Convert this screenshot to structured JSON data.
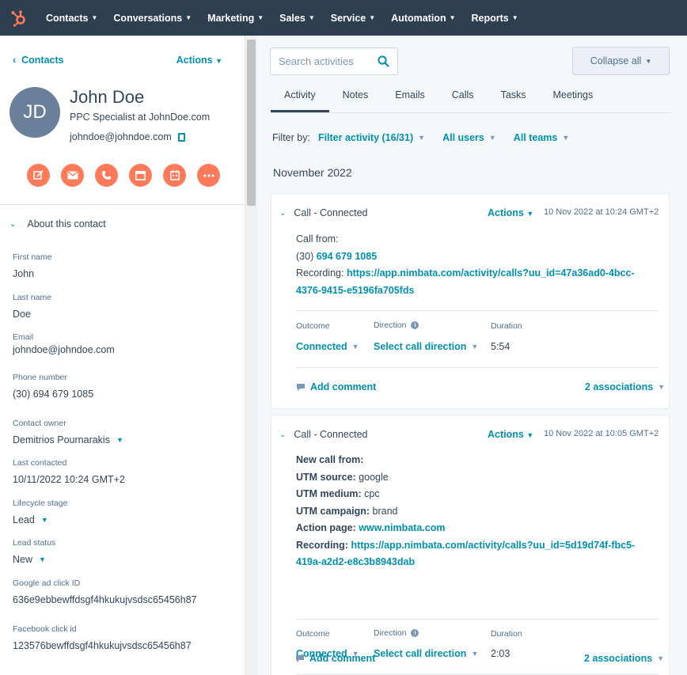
{
  "nav": {
    "items": [
      "Contacts",
      "Conversations",
      "Marketing",
      "Sales",
      "Service",
      "Automation",
      "Reports"
    ]
  },
  "sidebar": {
    "back_label": "Contacts",
    "actions_label": "Actions",
    "avatar_initials": "JD",
    "name": "John Doe",
    "job_title": "PPC Specialist at JohnDoe.com",
    "email": "johndoe@johndoe.com",
    "about_label": "About this contact",
    "props": {
      "first_name": {
        "label": "First name",
        "value": "John"
      },
      "last_name": {
        "label": "Last name",
        "value": "Doe"
      },
      "email": {
        "label": "Email",
        "value": "johndoe@johndoe.com"
      },
      "phone": {
        "label": "Phone number",
        "value": "(30) 694 679 1085"
      },
      "owner": {
        "label": "Contact owner",
        "value": "Demitrios Pournarakis"
      },
      "last_contacted": {
        "label": "Last contacted",
        "value": "10/11/2022 10:24 GMT+2"
      },
      "lifecycle": {
        "label": "Lifecycle stage",
        "value": "Lead"
      },
      "lead_status": {
        "label": "Lead status",
        "value": "New"
      },
      "google_click": {
        "label": "Google ad click ID",
        "value": "636e9ebbewffdsgf4hkukujvsdsc65456h87"
      },
      "facebook_click": {
        "label": "Facebook click id",
        "value": "123576bewffdsgf4hkukujvsdsc65456h87"
      }
    }
  },
  "main": {
    "search_placeholder": "Search activities",
    "collapse_label": "Collapse all",
    "tabs": [
      "Activity",
      "Notes",
      "Emails",
      "Calls",
      "Tasks",
      "Meetings"
    ],
    "filter_by": "Filter by:",
    "filter_activity": "Filter activity (16/31)",
    "all_users": "All users",
    "all_teams": "All teams",
    "month": "November 2022"
  },
  "cards": [
    {
      "title": "Call - Connected",
      "actions": "Actions",
      "date": "10 Nov 2022 at 10:24 GMT+2",
      "line1": "Call from:",
      "phone_prefix": "(30) ",
      "phone_link": "694 679 1085",
      "recording_label": "Recording: ",
      "recording_url_1": "https://app.nimbata.com/activity/calls?uu_id=47a36ad0-4bcc-",
      "recording_url_2": "4376-9415-e5196fa705fds",
      "outcome_label": "Outcome",
      "direction_label": "Direction",
      "duration_label": "Duration",
      "outcome": "Connected",
      "direction": "Select call direction",
      "duration": "5:54",
      "comment": "Add comment",
      "associations": "2 associations"
    },
    {
      "title": "Call - Connected",
      "actions": "Actions",
      "date": "10 Nov 2022 at 10:05 GMT+2",
      "line1": "New call from:",
      "utm_source_label": "UTM source:",
      "utm_source": " google",
      "utm_medium_label": "UTM medium:",
      "utm_medium": " cpc",
      "utm_campaign_label": "UTM campaign:",
      "utm_campaign": " brand",
      "action_page_label": "Action page:",
      "action_page": "www.nimbata.com",
      "recording_label": "Recording: ",
      "recording_url_1": "https://app.nimbata.com/activity/calls?uu_id=5d19d74f-fbc5-",
      "recording_url_2": "419a-a2d2-e8c3b8943dab",
      "outcome_label": "Outcome",
      "direction_label": "Direction",
      "duration_label": "Duration",
      "outcome": "Connected",
      "direction": "Select call direction",
      "duration": "2:03",
      "comment": "Add comment",
      "associations": "2 associations"
    }
  ]
}
